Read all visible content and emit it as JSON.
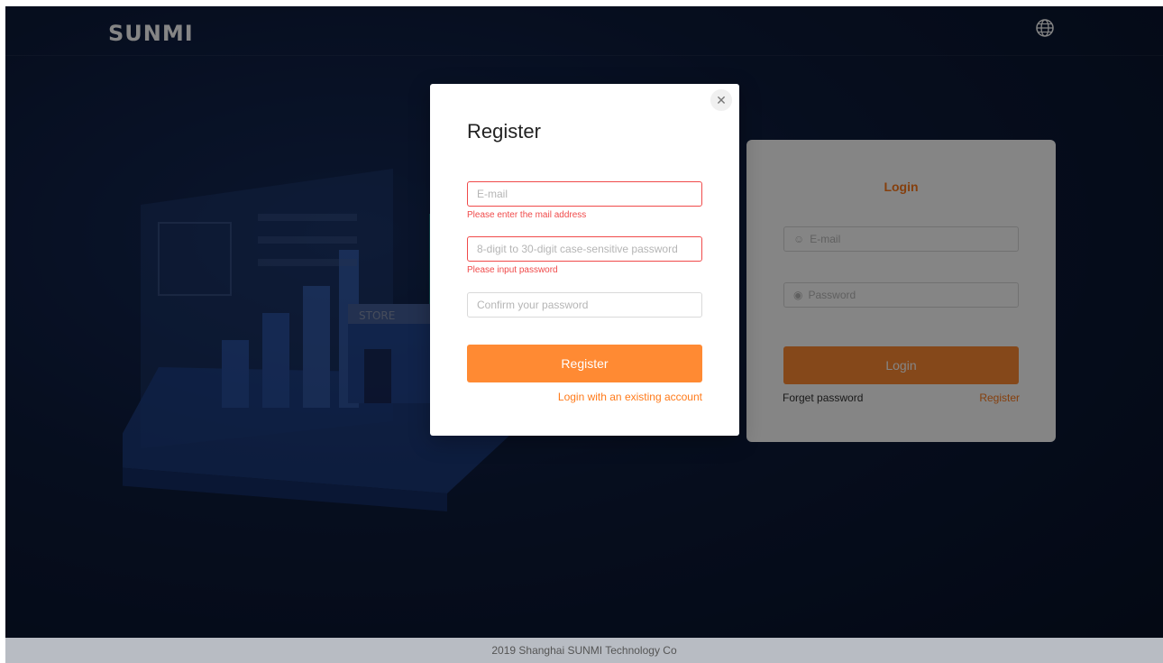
{
  "header": {
    "logo": "SUNMI",
    "language_icon": "globe-icon"
  },
  "illustration": {
    "store_sign": "STORE"
  },
  "login": {
    "title": "Login",
    "email_placeholder": "E-mail",
    "password_placeholder": "Password",
    "login_button": "Login",
    "forget_password": "Forget password",
    "register_link": "Register"
  },
  "modal": {
    "title": "Register",
    "email_placeholder": "E-mail",
    "email_error": "Please enter the mail address",
    "password_placeholder": "8-digit to 30-digit case-sensitive password",
    "password_error": "Please input password",
    "confirm_placeholder": "Confirm your password",
    "register_button": "Register",
    "existing_account_link": "Login with an existing account",
    "close_icon": "close-icon"
  },
  "footer": {
    "text": "2019 Shanghai SUNMI Technology Co"
  },
  "colors": {
    "accent": "#ff8a33",
    "error": "#f04a4a",
    "background": "#0d1b3b"
  }
}
